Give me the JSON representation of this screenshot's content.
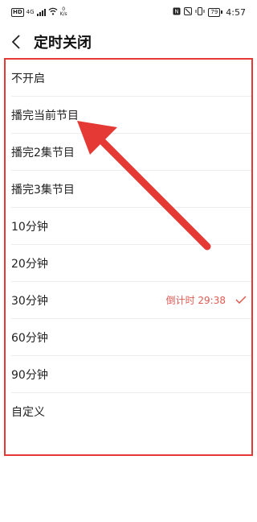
{
  "status_bar": {
    "hd_label": "HD",
    "network": "4G",
    "speed_value": "0",
    "speed_unit": "K/s",
    "battery": "79",
    "time": "4:57"
  },
  "header": {
    "back_icon": "chevron-left-icon",
    "title": "定时关闭"
  },
  "options": [
    {
      "label": "不开启"
    },
    {
      "label": "播完当前节目"
    },
    {
      "label": "播完2集节目"
    },
    {
      "label": "播完3集节目"
    },
    {
      "label": "10分钟"
    },
    {
      "label": "20分钟"
    },
    {
      "label": "30分钟",
      "selected": true,
      "countdown": "倒计时 29:38"
    },
    {
      "label": "60分钟"
    },
    {
      "label": "90分钟"
    },
    {
      "label": "自定义"
    }
  ],
  "colors": {
    "annotation_red": "#e53935",
    "countdown_red": "#e05a52"
  }
}
